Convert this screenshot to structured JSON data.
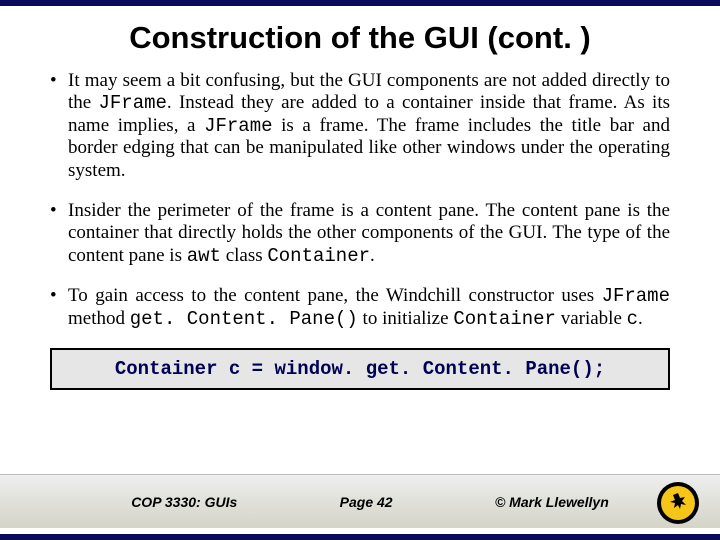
{
  "title": "Construction of the GUI (cont. )",
  "bullets": {
    "b1": {
      "t1": "It may seem a bit confusing, but the GUI components are not added directly to the ",
      "c1": "JFrame",
      "t2": ".  Instead they are added to a container inside that frame.  As its name implies, a ",
      "c2": "JFrame",
      "t3": " is a frame.  The frame includes the title bar and border edging that can be manipulated like other windows under the operating system."
    },
    "b2": {
      "t1": "Insider the perimeter of the frame is a content pane.  The content pane is the container that directly holds the other components of the GUI.  The type of the content pane is ",
      "c1": "awt",
      "t2": " class ",
      "c2": "Container",
      "t3": "."
    },
    "b3": {
      "t1": "To gain access to the content pane, the Windchill constructor uses ",
      "c1": "JFrame",
      "t2": " method ",
      "c2": "get. Content. Pane()",
      "t3": " to initialize ",
      "c3": "Container",
      "t4": " variable ",
      "c4": "c",
      "t5": "."
    }
  },
  "code": "Container c = window. get. Content. Pane();",
  "footer": {
    "course": "COP 3330:  GUIs",
    "page": "Page 42",
    "copyright": "© Mark Llewellyn"
  }
}
